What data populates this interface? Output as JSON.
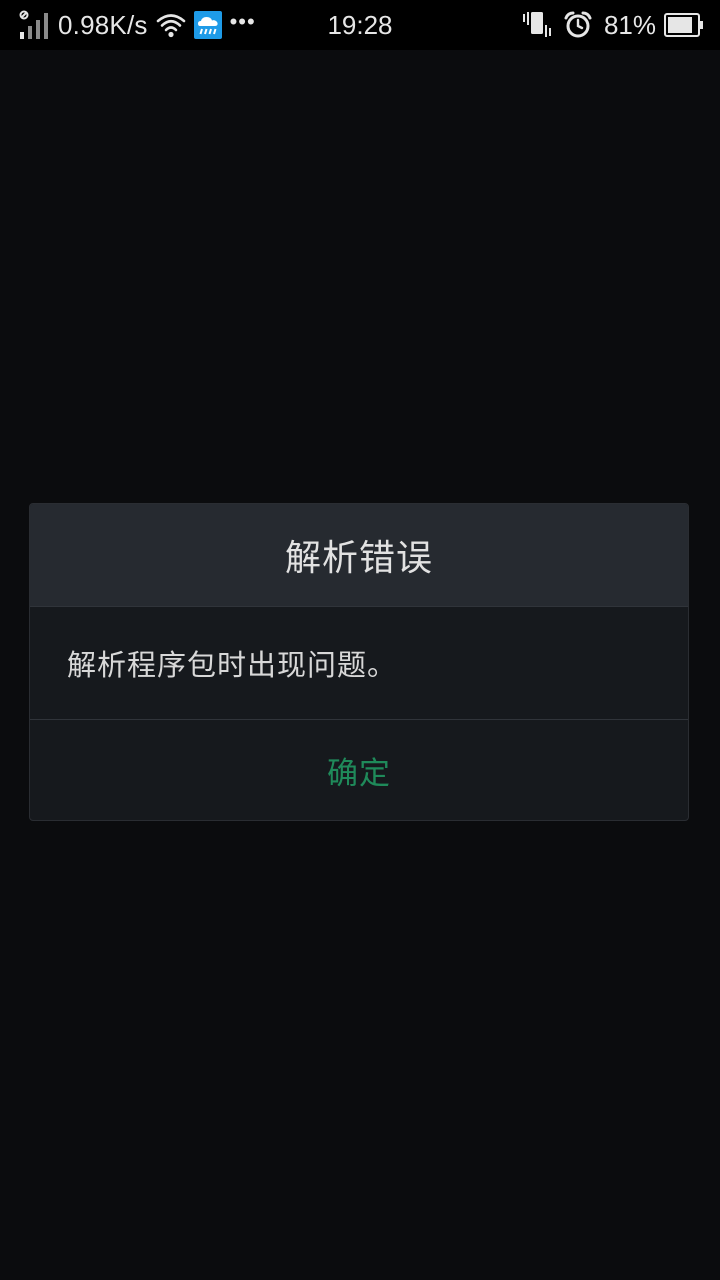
{
  "status_bar": {
    "network_speed": "0.98K/s",
    "time": "19:28",
    "battery_percent": "81%",
    "dots": "•••",
    "icons": [
      "signal-icon",
      "wifi-icon",
      "weather-rain-icon",
      "vibrate-icon",
      "alarm-icon",
      "battery-icon"
    ]
  },
  "dialog": {
    "title": "解析错误",
    "message": "解析程序包时出现问题。",
    "ok_label": "确定"
  },
  "colors": {
    "background": "#0b0c0e",
    "dialog_title_bg": "#262a30",
    "dialog_body_bg": "#16191d",
    "accent_green": "#1f8a5a",
    "weather_icon": "#1e9be8"
  }
}
